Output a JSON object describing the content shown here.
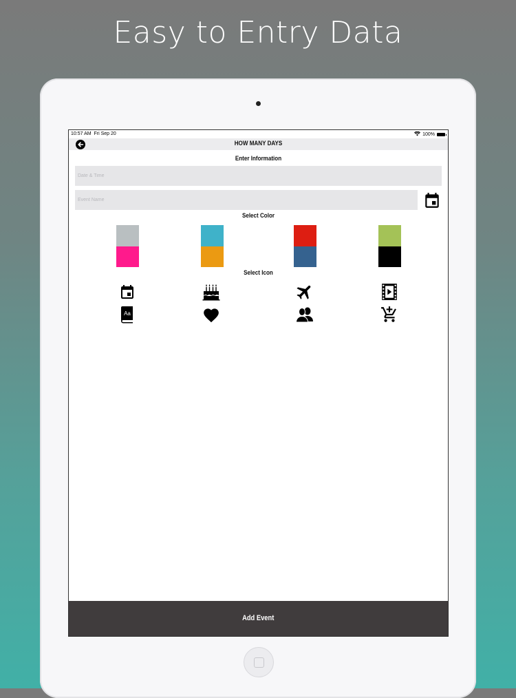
{
  "headline": "Easy to Entry Data",
  "status_bar": {
    "time": "10:57 AM",
    "date": "Fri Sep 20",
    "battery": "100%"
  },
  "nav": {
    "title": "HOW MANY DAYS",
    "back_icon": "back-arrow-icon"
  },
  "form": {
    "section_title": "Enter Information",
    "date_time_placeholder": "Date & Time",
    "event_name_placeholder": "Event Name",
    "calendar_button_icon": "calendar-icon"
  },
  "colors": {
    "section_title": "Select Color",
    "swatches": [
      {
        "top": "#b9bfc1",
        "bottom": "#ff1a8c"
      },
      {
        "top": "#3fb2c9",
        "bottom": "#eb9a12"
      },
      {
        "top": "#dd1e12",
        "bottom": "#35628f"
      },
      {
        "top": "#a4c257",
        "bottom": "#000000"
      }
    ]
  },
  "icons": {
    "section_title": "Select Icon",
    "items": [
      "calendar-icon",
      "birthday-cake-icon",
      "airplane-icon",
      "movie-icon",
      "book-icon",
      "heart-icon",
      "people-icon",
      "add-cart-icon"
    ]
  },
  "footer": {
    "add_label": "Add Event"
  }
}
